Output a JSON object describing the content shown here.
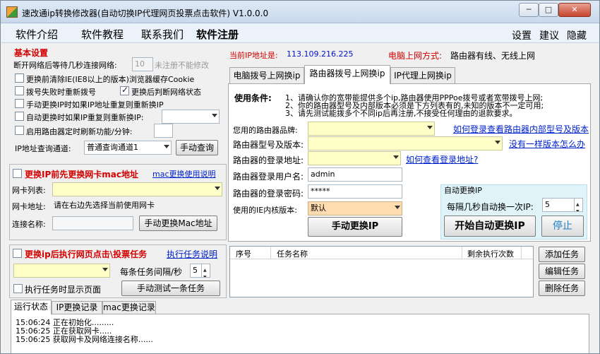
{
  "window": {
    "title": "速改通ip转换修改器(自动切换IP代理网页投票点击软件) V1.0.0.0",
    "min_label": "─",
    "max_label": "□",
    "close_label": "✕"
  },
  "menu": {
    "items": [
      "软件介绍",
      "软件教程",
      "联系我们",
      "软件注册"
    ],
    "right": [
      "设置",
      "建议",
      "隐藏"
    ]
  },
  "basic": {
    "title": "基本设置",
    "reconnect_label": "断开网络后等待几秒连接网络:",
    "reconnect_value": "10",
    "reconnect_hint": "未注册不能修改",
    "cb_clear_cache": "更换前清除IE(IE8以上的版本)浏览器缓存Cookie",
    "cb_redial": "拨号失败时重新拨号",
    "cb_check_net": "更换后判断网络状态",
    "cb_manual_repeat": "手动更换IP时如果IP地址重复则重新换IP",
    "cb_auto_repeat": "自动更换时如果IP重复则重新换IP:",
    "cb_router_timer": "启用路由器定时刷新功能/分钟:",
    "query_label": "IP地址查询通道:",
    "query_value": "普通查询通道1",
    "query_button": "手动查询"
  },
  "mac": {
    "title": "更换IP前先更换网卡mac地址",
    "help": "mac更换使用说明",
    "nic_list_label": "网卡列表:",
    "nic_addr_label": "网卡地址:",
    "nic_addr_value": "请在右边先选择当前使用网卡",
    "conn_label": "连接名称:",
    "change_button": "手动更换Mac地址"
  },
  "status": {
    "current_ip_label": "当前IP地址是:",
    "current_ip": "113.109.216.225",
    "net_mode_label": "电脑上网方式:",
    "net_mode": "路由器有线、无线上网"
  },
  "tabs": [
    "电脑拨号上网换ip",
    "路由器拨号上网换ip",
    "IP代理上网换ip"
  ],
  "router": {
    "cond_label": "使用条件:",
    "cond_lines": [
      "1、请确认你的宽带能提供多个ip,路由器使用PPPoe拨号或者宽带拨号上网;",
      "2、你的路由器型号及内部版本必须是下方列表有的,未知的版本不一定可用;",
      "3、请先测试能拨多个不同ip后再注册,不接受任何理由的退款要求。"
    ],
    "brand_label": "您用的路由器品牌:",
    "brand_link": "如何登录查看路由器内部型号及版本",
    "model_label": "路由器型号及版本:",
    "model_link": "没有一样版本怎么办",
    "login_addr_label": "路由器的登录地址:",
    "login_addr_link": "如何查看登录地址?",
    "user_label": "路由器登录用户名:",
    "user_value": "admin",
    "pwd_label": "路由器的登录密码:",
    "pwd_value": "*****",
    "ie_label": "使用的IE内核版本:",
    "ie_value": "默认",
    "manual_button": "手动更换IP"
  },
  "auto": {
    "group": "自动更换IP",
    "interval_label": "每隔几秒自动换一次IP:",
    "interval_value": "5",
    "start_button": "开始自动更换IP",
    "stop_button": "停止"
  },
  "task": {
    "title": "更换ip后执行网页点击\\投票任务",
    "help": "执行任务说明",
    "interval_label": "每条任务间隔/秒",
    "interval_value": "5",
    "cb_show": "执行任务时显示页面",
    "test_button": "手动测试一条任务",
    "columns": [
      "序号",
      "任务名称",
      "剩余执行次数"
    ],
    "add_button": "添加任务",
    "edit_button": "编辑任务",
    "delete_button": "删除任务"
  },
  "log": {
    "tabs": [
      "运行状态",
      "IP更换记录",
      "mac更换记录"
    ],
    "lines": [
      "15:06:24 正在初始化.........",
      "15:06:25 正在获取网卡.....",
      "15:06:25 获取网卡及网络连接名称......"
    ]
  }
}
